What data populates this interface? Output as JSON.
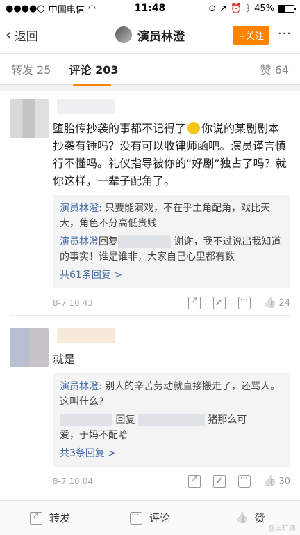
{
  "status_bar": {
    "carrier": "中国电信",
    "time": "11:48",
    "battery": "45%",
    "battery_level": 0.45
  },
  "nav": {
    "back_label": "返回",
    "title": "演员林澄",
    "follow_label": "+关注",
    "more_icon": "more-icon"
  },
  "tabs": {
    "reposts_label": "转发",
    "reposts_count": "25",
    "comments_label": "评论",
    "comments_count": "203",
    "likes_label": "赞",
    "likes_count": "64"
  },
  "comments": [
    {
      "body_part1": "堕胎传抄袭的事都不记得了",
      "body_part2": "你说的某剧剧本抄袭有锤吗？没有可以收律师函吧。演员谨言慎行不懂吗。礼仪指导被你的“好剧”独占了吗？就你这样，一辈子配角了。",
      "replies": [
        {
          "name": "演员林澄",
          "sep": ":",
          "text": "只要能演戏，不在乎主角配角，戏比天大，角色不分高低贵贱"
        },
        {
          "name": "演员林澄",
          "reply_word": "回复",
          "text": "谢谢，我不过说出我知道的事实！谁是谁非，大家自己心里都有数"
        }
      ],
      "more_replies": "共61条回复 >",
      "time": "8-7 10:43",
      "likes": "24"
    },
    {
      "body": "就是",
      "replies": [
        {
          "name": "演员林澄",
          "sep": ":",
          "text": "别人的辛苦劳动就直接搬走了，还骂人。这叫什么?"
        },
        {
          "reply_word": "回复",
          "text_part1": "猪那么可",
          "text_part2": "爱，于妈不配哈"
        }
      ],
      "more_replies": "共3条回复 >",
      "time": "8-7 10:04",
      "likes": "30"
    }
  ],
  "toolbar": {
    "repost_label": "转发",
    "comment_label": "评论",
    "like_label": "赞"
  },
  "watermark": "@王扩逸"
}
